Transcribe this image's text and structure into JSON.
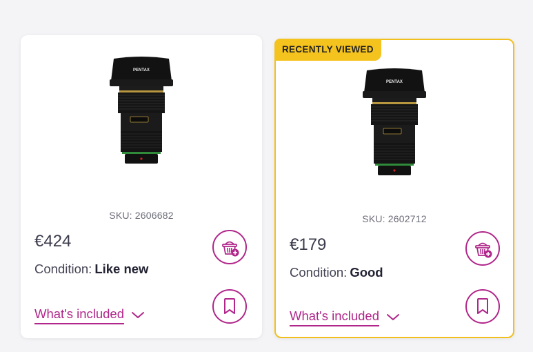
{
  "cards": [
    {
      "brand": "PENTAX",
      "sku_label": "SKU:",
      "sku": "2606682",
      "price": "€424",
      "condition_label": "Condition:",
      "condition": "Like new",
      "included_label": "What's included"
    },
    {
      "badge": "RECENTLY VIEWED",
      "brand": "PENTAX",
      "sku_label": "SKU:",
      "sku": "2602712",
      "price": "€179",
      "condition_label": "Condition:",
      "condition": "Good",
      "included_label": "What's included"
    }
  ],
  "colors": {
    "accent": "#b0268a",
    "badge": "#f5c31e",
    "highlight_border": "#f2c01e"
  },
  "icons": [
    "add-to-basket-icon",
    "bookmark-icon",
    "chevron-down-icon"
  ]
}
